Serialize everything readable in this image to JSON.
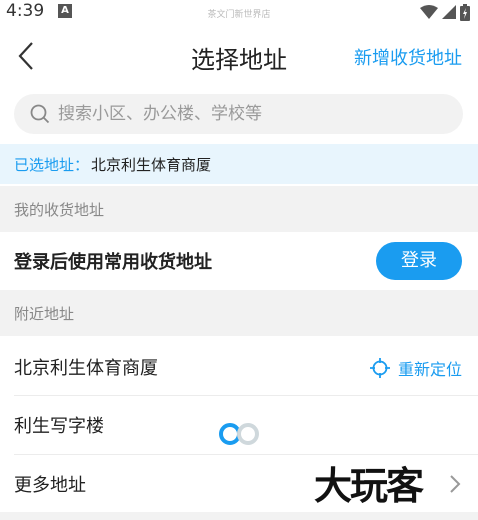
{
  "status_bar": {
    "time": "4:39",
    "badge": "A",
    "center_text": "茶文门新世界店"
  },
  "header": {
    "title": "选择地址",
    "add_address": "新增收货地址"
  },
  "search": {
    "placeholder": "搜索小区、办公楼、学校等"
  },
  "selected": {
    "label": "已选地址：",
    "value": "北京利生体育商厦"
  },
  "my_addresses": {
    "section_title": "我的收货地址",
    "login_prompt": "登录后使用常用收货地址",
    "login_button": "登录"
  },
  "nearby": {
    "section_title": "附近地址",
    "relocate_label": "重新定位",
    "items": [
      {
        "name": "北京利生体育商厦"
      },
      {
        "name": "利生写字楼"
      },
      {
        "name": "更多地址"
      }
    ]
  },
  "watermark": "大玩客",
  "colors": {
    "accent": "#1a9cf0",
    "selected_bg": "#e8f5fd",
    "section_bg": "#f2f2f2"
  }
}
